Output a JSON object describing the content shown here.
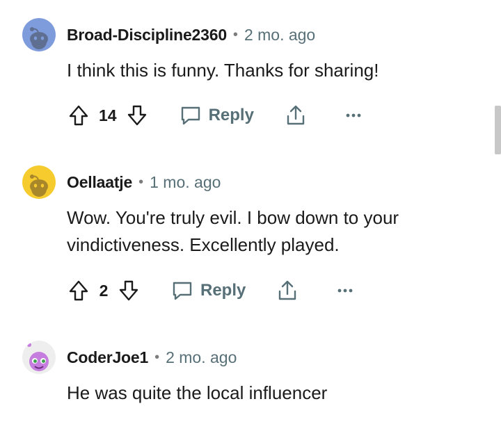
{
  "comments": [
    {
      "username": "Broad-Discipline2360",
      "separator": "•",
      "time": "2 mo. ago",
      "body": "I think this is funny. Thanks for sharing!",
      "score": "14",
      "reply_label": "Reply",
      "avatar_icon": "snoo-avatar-icon",
      "avatar_color": "#7e9bdc"
    },
    {
      "username": "Oellaatje",
      "separator": "•",
      "time": "1 mo. ago",
      "body": "Wow. You're truly evil. I bow down to your vindictiveness. Excellently played.",
      "score": "2",
      "reply_label": "Reply",
      "avatar_icon": "snoo-avatar-icon",
      "avatar_color": "#f6cb2e"
    },
    {
      "username": "CoderJoe1",
      "separator": "•",
      "time": "2 mo. ago",
      "body": "He was quite the local influencer",
      "avatar_icon": "snoo-alien-avatar-icon",
      "avatar_color": "#c57ede"
    }
  ],
  "colors": {
    "text": "#1a1a1b",
    "muted": "#576f76",
    "scrollbar": "#c7c7c7"
  }
}
